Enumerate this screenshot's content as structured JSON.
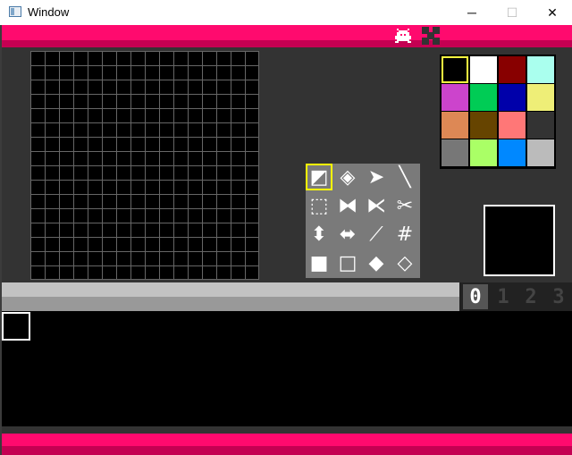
{
  "window": {
    "title": "Window",
    "controls": {
      "minimize": "─",
      "maximize": "☐",
      "close": "✕"
    }
  },
  "menubar": {
    "icons": [
      "bug-icon",
      "checker-icon"
    ],
    "colors": {
      "bar": "#ff0a6e",
      "shadow": "#c40052"
    }
  },
  "palette": {
    "selected_index": 0,
    "colors": [
      "#000000",
      "#ffffff",
      "#880000",
      "#aaffee",
      "#cc44cc",
      "#00cc55",
      "#0000aa",
      "#eeee77",
      "#dd8855",
      "#664400",
      "#ff7777",
      "#333333",
      "#777777",
      "#aaff66",
      "#0088ff",
      "#bbbbbb"
    ]
  },
  "tools": {
    "selected_index": 0,
    "items": [
      {
        "name": "pencil-tool",
        "glyph": "◩"
      },
      {
        "name": "stamp-tool",
        "glyph": "◈"
      },
      {
        "name": "brush-tool",
        "glyph": "➤"
      },
      {
        "name": "line-tool",
        "glyph": "╲"
      },
      {
        "name": "select-tool",
        "glyph": "⬚"
      },
      {
        "name": "flip-h-tool",
        "glyph": "⧓"
      },
      {
        "name": "flip-v-tool",
        "glyph": "⧔"
      },
      {
        "name": "cut-tool",
        "glyph": "✂"
      },
      {
        "name": "mirror-v-tool",
        "glyph": "⬍"
      },
      {
        "name": "mirror-h-tool",
        "glyph": "⬌"
      },
      {
        "name": "fill-tool",
        "glyph": "⟋"
      },
      {
        "name": "grid-tool",
        "glyph": "#"
      },
      {
        "name": "rect-fill-tool",
        "glyph": "■"
      },
      {
        "name": "rect-tool",
        "glyph": "□"
      },
      {
        "name": "circle-fill-tool",
        "glyph": "◆"
      },
      {
        "name": "circle-tool",
        "glyph": "◇"
      }
    ]
  },
  "banks": {
    "labels": [
      "0",
      "1",
      "2",
      "3"
    ],
    "selected_index": 0
  },
  "canvas": {
    "grid_cells": 16,
    "grid_color": "#666666"
  }
}
